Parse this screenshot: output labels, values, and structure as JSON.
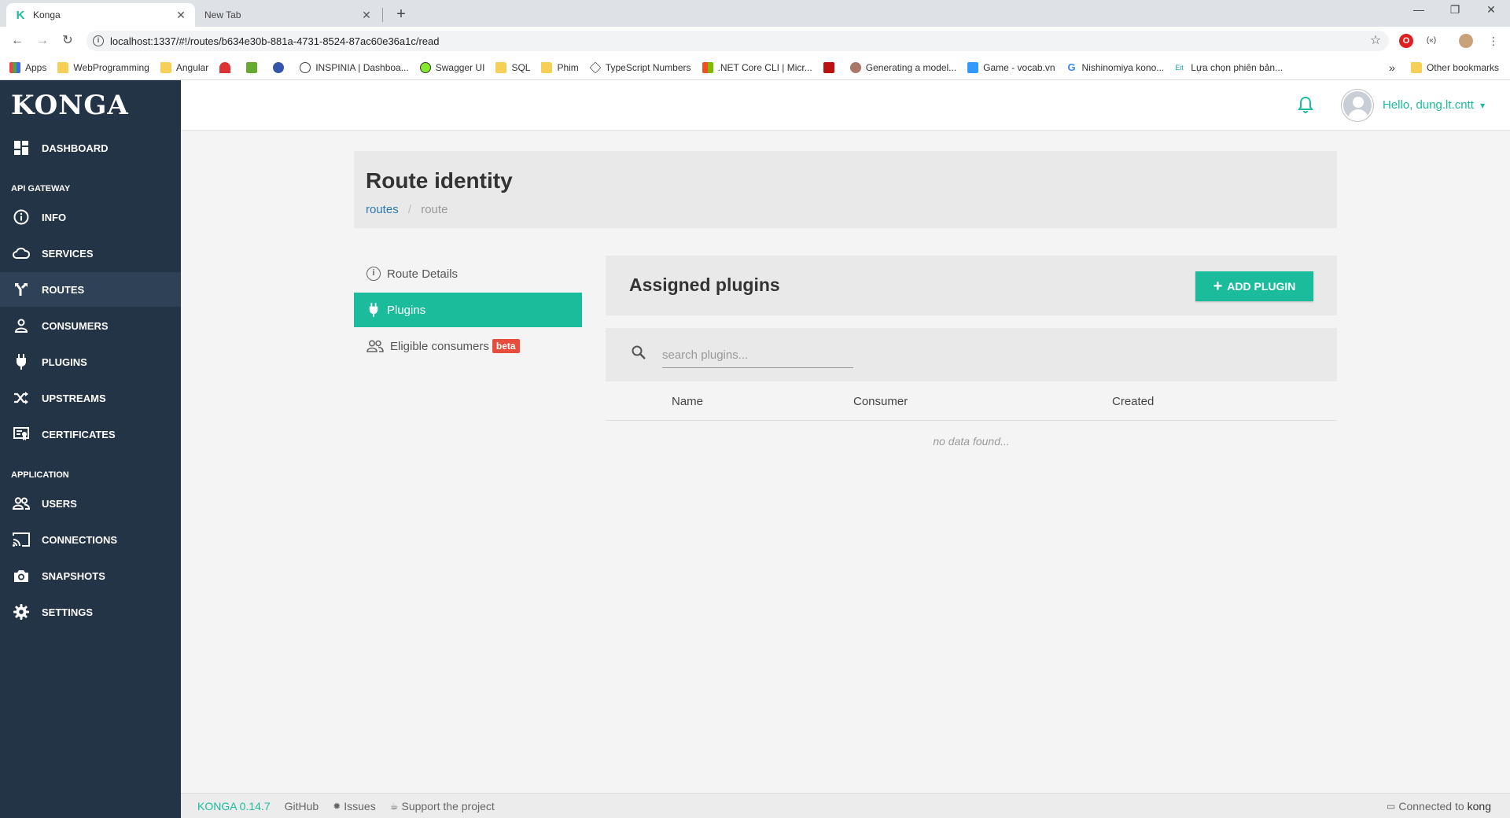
{
  "browser": {
    "tabs": [
      {
        "title": "Konga",
        "active": true
      },
      {
        "title": "New Tab",
        "active": false
      }
    ],
    "url": "localhost:1337/#!/routes/b634e30b-881a-4731-8524-87ac60e36a1c/read",
    "bookmarks": [
      {
        "label": "Apps",
        "icon": "apps-grid-icon"
      },
      {
        "label": "WebProgramming",
        "icon": "folder-icon"
      },
      {
        "label": "Angular",
        "icon": "folder-icon"
      },
      {
        "label": "",
        "icon": "site-icon"
      },
      {
        "label": "",
        "icon": "site-icon"
      },
      {
        "label": "",
        "icon": "site-icon"
      },
      {
        "label": "INSPINIA | Dashboa...",
        "icon": "site-icon"
      },
      {
        "label": "Swagger UI",
        "icon": "swagger-icon"
      },
      {
        "label": "SQL",
        "icon": "folder-icon"
      },
      {
        "label": "Phim",
        "icon": "folder-icon"
      },
      {
        "label": "TypeScript Numbers",
        "icon": "site-icon"
      },
      {
        "label": ".NET Core CLI | Micr...",
        "icon": "microsoft-icon"
      },
      {
        "label": "",
        "icon": "site-icon"
      },
      {
        "label": "Generating a model...",
        "icon": "site-icon"
      },
      {
        "label": "Game - vocab.vn",
        "icon": "site-icon"
      },
      {
        "label": "Nishinomiya kono...",
        "icon": "google-icon"
      },
      {
        "label": "Lựa chọn phiên bản...",
        "icon": "site-icon"
      }
    ],
    "bookmarks_more": "»",
    "other_bookmarks": "Other bookmarks"
  },
  "sidebar": {
    "logo": "KONGA",
    "dashboard": "DASHBOARD",
    "section_api": "API GATEWAY",
    "api_items": [
      {
        "label": "INFO",
        "icon": "info-icon"
      },
      {
        "label": "SERVICES",
        "icon": "cloud-icon"
      },
      {
        "label": "ROUTES",
        "icon": "routes-icon",
        "active": true
      },
      {
        "label": "CONSUMERS",
        "icon": "person-icon"
      },
      {
        "label": "PLUGINS",
        "icon": "plug-icon"
      },
      {
        "label": "UPSTREAMS",
        "icon": "shuffle-icon"
      },
      {
        "label": "CERTIFICATES",
        "icon": "certificate-icon"
      }
    ],
    "section_app": "APPLICATION",
    "app_items": [
      {
        "label": "USERS",
        "icon": "users-icon"
      },
      {
        "label": "CONNECTIONS",
        "icon": "cast-icon"
      },
      {
        "label": "SNAPSHOTS",
        "icon": "camera-icon"
      },
      {
        "label": "SETTINGS",
        "icon": "gear-icon"
      }
    ]
  },
  "header": {
    "greeting": "Hello, dung.lt.cntt",
    "caret": "▾"
  },
  "page": {
    "title": "Route identity",
    "breadcrumb": {
      "link": "routes",
      "separator": "/",
      "current": "route"
    }
  },
  "side_menu": {
    "route_details": "Route Details",
    "plugins": "Plugins",
    "eligible_consumers": "Eligible consumers",
    "beta": "beta"
  },
  "plugins_panel": {
    "title": "Assigned plugins",
    "add_button": "ADD PLUGIN",
    "search_placeholder": "search plugins...",
    "columns": [
      "Name",
      "Consumer",
      "Created"
    ],
    "empty": "no data found..."
  },
  "footer": {
    "version": "KONGA 0.14.7",
    "github": "GitHub",
    "issues": "Issues",
    "support": "Support the project",
    "connected_prefix": "Connected to",
    "connection": "kong"
  },
  "colors": {
    "accent": "#1abc9c",
    "sidebar": "#243447",
    "beta_badge": "#e74c3c",
    "link": "#2a7ab5"
  }
}
